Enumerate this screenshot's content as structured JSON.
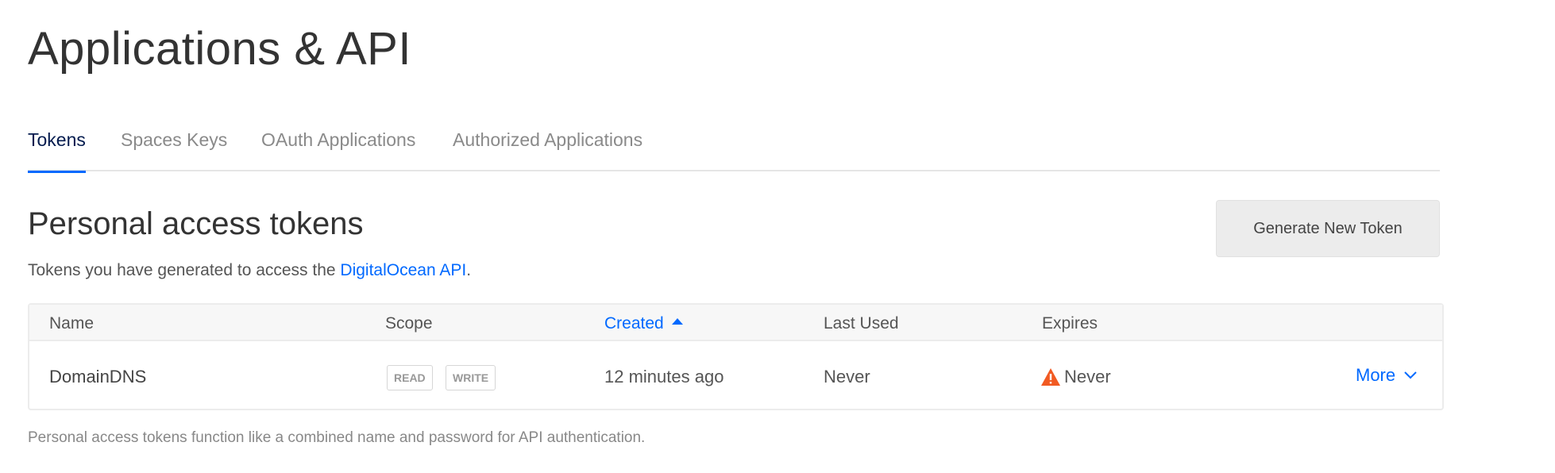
{
  "page": {
    "title": "Applications & API"
  },
  "tabs": [
    {
      "label": "Tokens",
      "active": true
    },
    {
      "label": "Spaces Keys",
      "active": false
    },
    {
      "label": "OAuth Applications",
      "active": false
    },
    {
      "label": "Authorized Applications",
      "active": false
    }
  ],
  "section": {
    "title": "Personal access tokens",
    "description_prefix": "Tokens you have generated to access the ",
    "description_link": "DigitalOcean API",
    "description_suffix": ".",
    "generate_button": "Generate New Token"
  },
  "table": {
    "headers": {
      "name": "Name",
      "scope": "Scope",
      "created": "Created",
      "last_used": "Last Used",
      "expires": "Expires"
    },
    "sort": {
      "column": "Created",
      "direction": "ascending"
    },
    "rows": [
      {
        "name": "DomainDNS",
        "scopes": [
          "READ",
          "WRITE"
        ],
        "created": "12 minutes ago",
        "last_used": "Never",
        "expires": "Never",
        "expires_icon": "warning-icon",
        "action": "More",
        "action_icon": "chevron-down-icon"
      }
    ]
  },
  "footnote": "Personal access tokens function like a combined name and password for API authentication.",
  "colors": {
    "accent": "#0069ff",
    "warning": "#f15a22",
    "active_tab_text": "#031b4e",
    "button_bg": "#ececec"
  }
}
